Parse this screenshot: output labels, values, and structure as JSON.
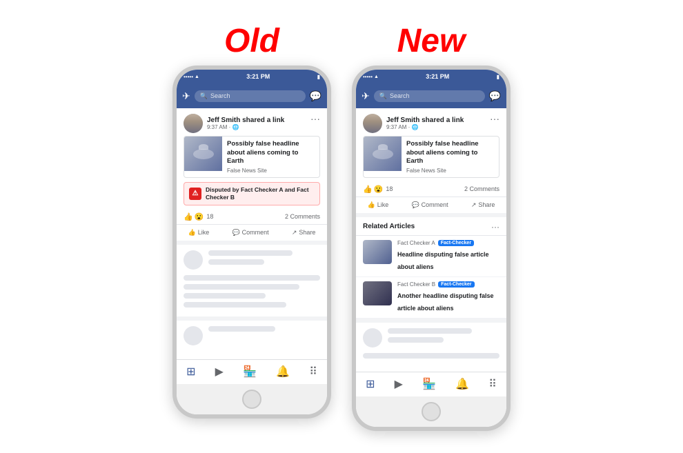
{
  "page": {
    "background": "#ffffff"
  },
  "old_label": "Old",
  "new_label": "New",
  "phone_old": {
    "status": {
      "dots": "•••••",
      "wifi": "▲",
      "time": "3:21 PM",
      "battery": "🔋"
    },
    "nav": {
      "search_placeholder": "Search"
    },
    "post": {
      "author": "Jeff Smith shared a link",
      "time": "9:37 AM · 🌐",
      "dots": "···",
      "link_title": "Possibly false headline about aliens coming to Earth",
      "link_source": "False News Site",
      "disputed_text": "Disputed by Fact Checker A and Fact Checker B",
      "reaction_count": "18",
      "comments_count": "2 Comments",
      "like_label": "Like",
      "comment_label": "Comment",
      "share_label": "Share"
    }
  },
  "phone_new": {
    "status": {
      "dots": "•••••",
      "wifi": "▲",
      "time": "3:21 PM",
      "battery": "🔋"
    },
    "nav": {
      "search_placeholder": "Search"
    },
    "post": {
      "author": "Jeff Smith shared a link",
      "time": "9:37 AM · 🌐",
      "dots": "···",
      "link_title": "Possibly false headline about aliens coming to Earth",
      "link_source": "False News Site",
      "reaction_count": "18",
      "comments_count": "2 Comments",
      "like_label": "Like",
      "comment_label": "Comment",
      "share_label": "Share"
    },
    "related": {
      "title": "Related Articles",
      "dots": "···",
      "items": [
        {
          "source": "Fact Checker A",
          "badge": "Fact-Checker",
          "headline": "Headline disputing false article about aliens"
        },
        {
          "source": "Fact Checker B",
          "badge": "Fact-Checker",
          "headline": "Another headline disputing false article about aliens"
        }
      ]
    }
  }
}
